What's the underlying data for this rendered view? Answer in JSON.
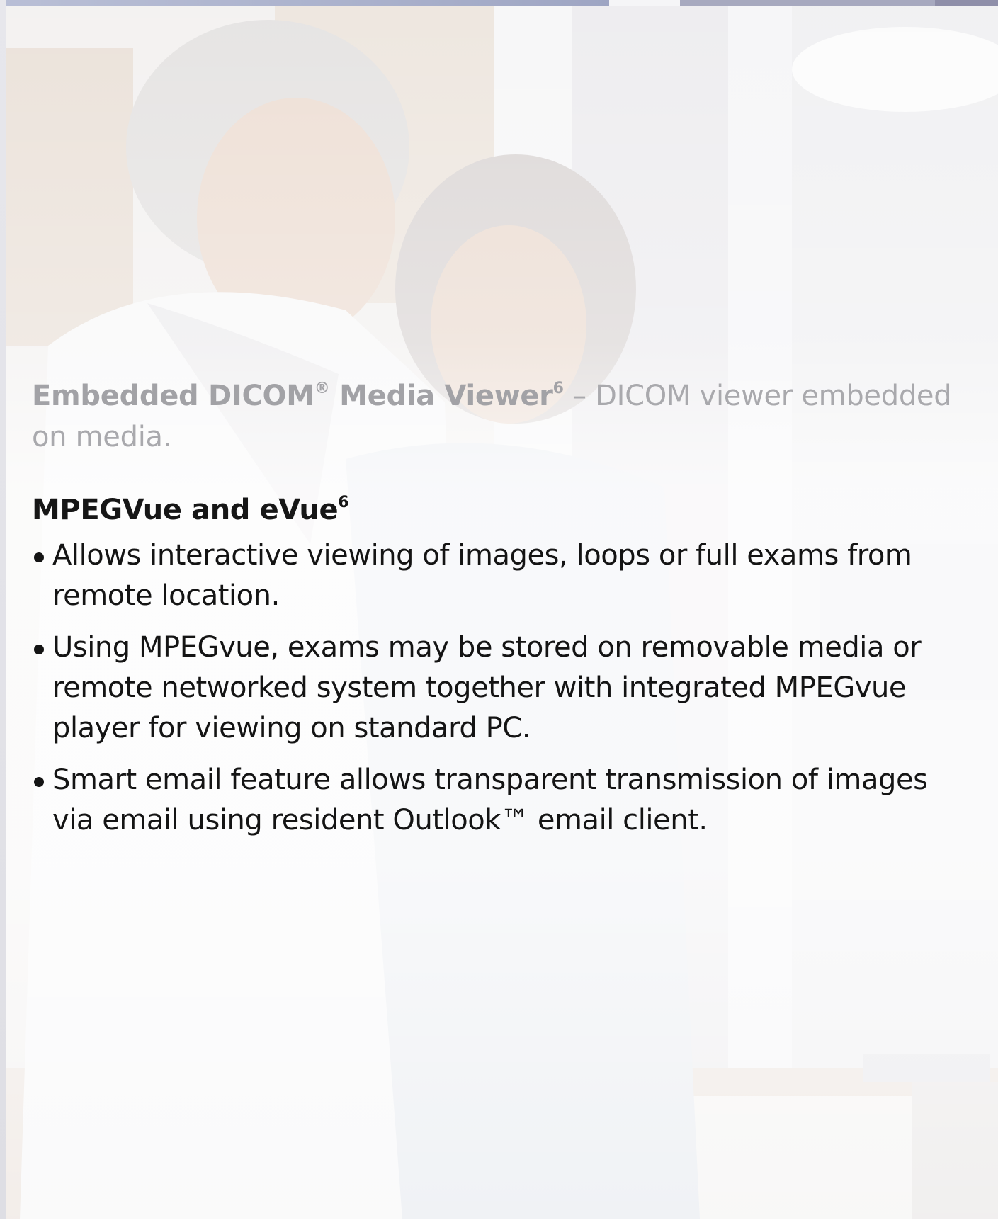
{
  "intro": {
    "title": "Embedded DICOM",
    "registered_mark": "®",
    "title_rest": " Media Viewer",
    "footnote": "6",
    "description": " – DICOM viewer embedded on media."
  },
  "section": {
    "heading": "MPEGVue and eVue",
    "heading_footnote": "6",
    "bullets": [
      "Allows interactive viewing of images, loops or full exams from remote location.",
      "Using MPEGvue, exams may be stored on removable media or remote networked system together with integrated MPEGvue player for viewing on standard PC.",
      "Smart email feature allows transparent transmission of images via email using resident Outlook™ email client."
    ]
  }
}
